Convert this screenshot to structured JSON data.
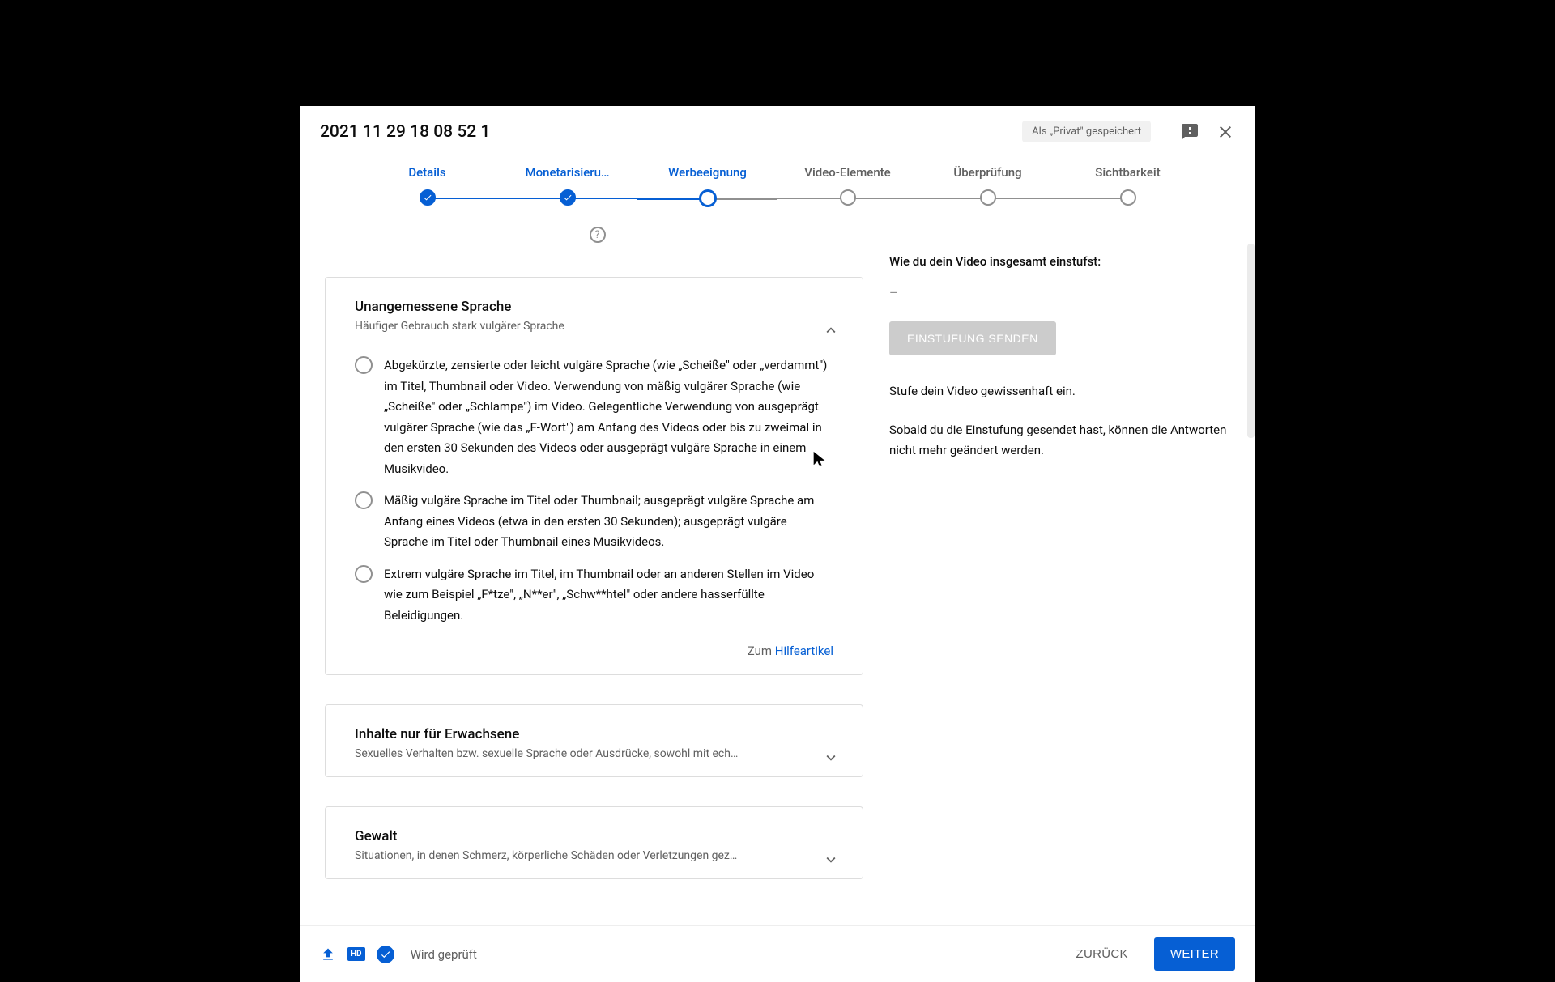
{
  "header": {
    "title": "2021 11 29 18 08 52 1",
    "private_badge": "Als „Privat\" gespeichert"
  },
  "stepper": {
    "items": [
      {
        "label": "Details",
        "state": "done"
      },
      {
        "label": "Monetarisieru…",
        "state": "done"
      },
      {
        "label": "Werbeeignung",
        "state": "active"
      },
      {
        "label": "Video-Elemente",
        "state": "pending"
      },
      {
        "label": "Überprüfung",
        "state": "pending"
      },
      {
        "label": "Sichtbarkeit",
        "state": "pending"
      }
    ]
  },
  "help_icon": "?",
  "cards": {
    "language": {
      "title": "Unangemessene Sprache",
      "subtitle": "Häufiger Gebrauch stark vulgärer Sprache",
      "options": [
        "Abgekürzte, zensierte oder leicht vulgäre Sprache (wie „Scheiße\" oder „verdammt\") im Titel, Thumbnail oder Video. Verwendung von mäßig vulgärer Sprache (wie „Scheiße\" oder „Schlampe\") im Video. Gelegentliche Verwendung von ausgeprägt vulgärer Sprache (wie das „F-Wort\") am Anfang des Videos oder bis zu zweimal in den ersten 30 Sekunden des Videos oder ausgeprägt vulgäre Sprache in einem Musikvideo.",
        "Mäßig vulgäre Sprache im Titel oder Thumbnail; ausgeprägt vulgäre Sprache am Anfang eines Videos (etwa in den ersten 30 Sekunden); ausgeprägt vulgäre Sprache im Titel oder Thumbnail eines Musikvideos.",
        "Extrem vulgäre Sprache im Titel, im Thumbnail oder an anderen Stellen im Video wie zum Beispiel „F*tze\", „N**er\", „Schw**htel\" oder andere hasserfüllte Beleidigungen."
      ],
      "help_prefix": "Zum ",
      "help_link": "Hilfeartikel"
    },
    "adult": {
      "title": "Inhalte nur für Erwachsene",
      "subtitle": "Sexuelles Verhalten bzw. sexuelle Sprache oder Ausdrücke, sowohl mit ech…"
    },
    "violence": {
      "title": "Gewalt",
      "subtitle": "Situationen, in denen Schmerz, körperliche Schäden oder Verletzungen gez…"
    }
  },
  "sidebar": {
    "title": "Wie du dein Video insgesamt einstufst:",
    "rating_placeholder": "–",
    "send_button": "EINSTUFUNG SENDEN",
    "p1": "Stufe dein Video gewissenhaft ein.",
    "p2": "Sobald du die Einstufung gesendet hast, können die Antworten nicht mehr geändert werden."
  },
  "footer": {
    "hd": "HD",
    "status": "Wird geprüft",
    "back": "ZURÜCK",
    "next": "WEITER"
  }
}
